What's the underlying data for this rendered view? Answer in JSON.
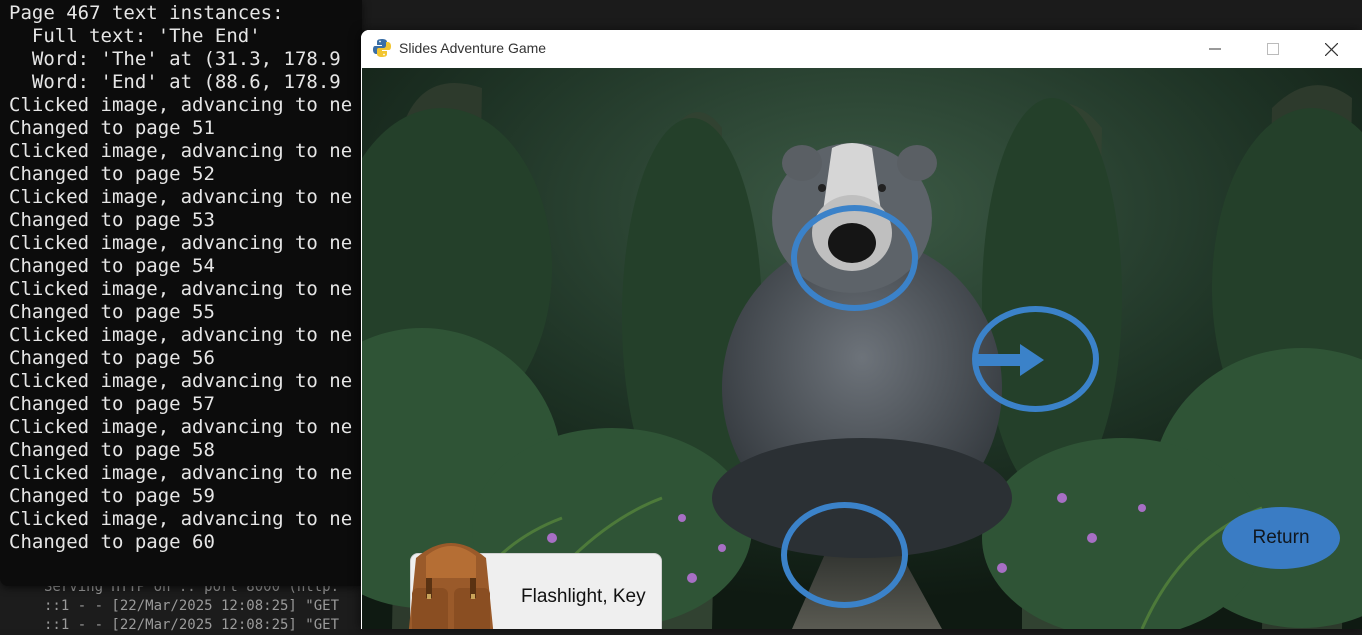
{
  "bg_terminal": {
    "lines": [
      "Serving HTTP on :: port 8000 (http:",
      "::1 - - [22/Mar/2025 12:08:25] \"GET",
      "::1 - - [22/Mar/2025 12:08:25] \"GET"
    ]
  },
  "terminal": {
    "lines": [
      "Page 467 text instances:",
      "  Full text: 'The End'",
      "  Word: 'The' at (31.3, 178.9",
      "  Word: 'End' at (88.6, 178.9",
      "Clicked image, advancing to ne",
      "Changed to page 51",
      "Clicked image, advancing to ne",
      "Changed to page 52",
      "Clicked image, advancing to ne",
      "Changed to page 53",
      "Clicked image, advancing to ne",
      "Changed to page 54",
      "Clicked image, advancing to ne",
      "Changed to page 55",
      "Clicked image, advancing to ne",
      "Changed to page 56",
      "Clicked image, advancing to ne",
      "Changed to page 57",
      "Clicked image, advancing to ne",
      "Changed to page 58",
      "Clicked image, advancing to ne",
      "Changed to page 59",
      "Clicked image, advancing to ne",
      "Changed to page 60"
    ]
  },
  "game_window": {
    "title": "Slides Adventure Game",
    "icon": "python-icon",
    "controls": [
      "minimize-icon",
      "maximize-icon",
      "close-icon"
    ]
  },
  "scene": {
    "description_icon": "badger-statue-garden-scene",
    "hotspots": [
      "badger-mouth-hotspot",
      "right-arrow-hotspot",
      "ground-hotspot"
    ],
    "return_label": "Return",
    "inventory_label": "Flashlight, Key",
    "accent_color": "#3b82c9"
  }
}
